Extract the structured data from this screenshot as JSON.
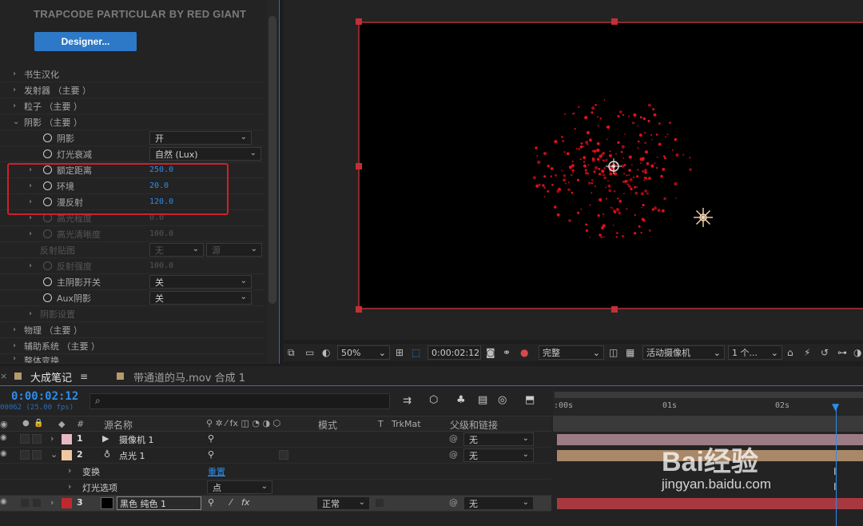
{
  "effect_panel": {
    "plugin_title": "TRAPCODE PARTICULAR BY RED GIANT",
    "designer_button": "Designer...",
    "rows": [
      {
        "label": "书生汉化",
        "arrow": "›"
      },
      {
        "label": "发射器 （主要 ）",
        "arrow": "›"
      },
      {
        "label": "粒子 （主要 ）",
        "arrow": "›"
      },
      {
        "label": "阴影 （主要 ）",
        "arrow": "⌄"
      },
      {
        "label": "阴影",
        "value": "开"
      },
      {
        "label": "灯光衰减",
        "value": "自然 (Lux)"
      },
      {
        "label": "额定距离",
        "value": "250.0"
      },
      {
        "label": "环境",
        "value": "20.0"
      },
      {
        "label": "漫反射",
        "value": "120.0"
      },
      {
        "label": "高光程度",
        "value": "0.0"
      },
      {
        "label": "高光清晰度",
        "value": "100.0"
      },
      {
        "label": "反射贴图",
        "value": "无",
        "value2": "源"
      },
      {
        "label": "反射强度",
        "value": "100.0"
      },
      {
        "label": "主阴影开关",
        "value": "关"
      },
      {
        "label": "Aux阴影",
        "value": "关"
      },
      {
        "label": "阴影设置"
      },
      {
        "label": "物理 （主要 ）"
      },
      {
        "label": "辅助系统 （主要 ）"
      },
      {
        "label": "整体变换"
      }
    ]
  },
  "viewer_bar": {
    "zoom": "50%",
    "timecode": "0:00:02:12",
    "resolution": "完整",
    "camera": "活动摄像机",
    "views": "1 个..."
  },
  "timeline": {
    "tabs": [
      {
        "label": "大成笔记",
        "active": true,
        "color": "#b59a6a"
      },
      {
        "label": "带通道的马.mov 合成 1",
        "active": false,
        "color": "#b59a6a"
      }
    ],
    "timecode": "0:00:02:12",
    "fps": "00062 (25.00 fps)",
    "columns": {
      "num": "#",
      "source": "源名称",
      "mode": "模式",
      "t": "T",
      "trkmat": "TrkMat",
      "parent": "父级和链接"
    },
    "layers": [
      {
        "num": "1",
        "name": "摄像机 1",
        "color": "#e8b8c4",
        "parent": "无",
        "bar_color": "#9c7c84"
      },
      {
        "num": "2",
        "name": "点光 1",
        "color": "#f0c8a0",
        "parent": "无",
        "bar_color": "#a88868"
      },
      {
        "num": "3",
        "name": "黑色 纯色 1",
        "color": "#c0282e",
        "mode": "正常",
        "parent": "无",
        "bar_color": "#a83840"
      }
    ],
    "sub_rows": [
      {
        "label": "变换",
        "value": "重置"
      },
      {
        "label": "灯光选项",
        "value": "点"
      }
    ],
    "ruler_labels": [
      ":00s",
      "01s",
      "02s"
    ]
  },
  "watermark": {
    "text": "Bai经验",
    "url": "jingyan.baidu.com"
  }
}
